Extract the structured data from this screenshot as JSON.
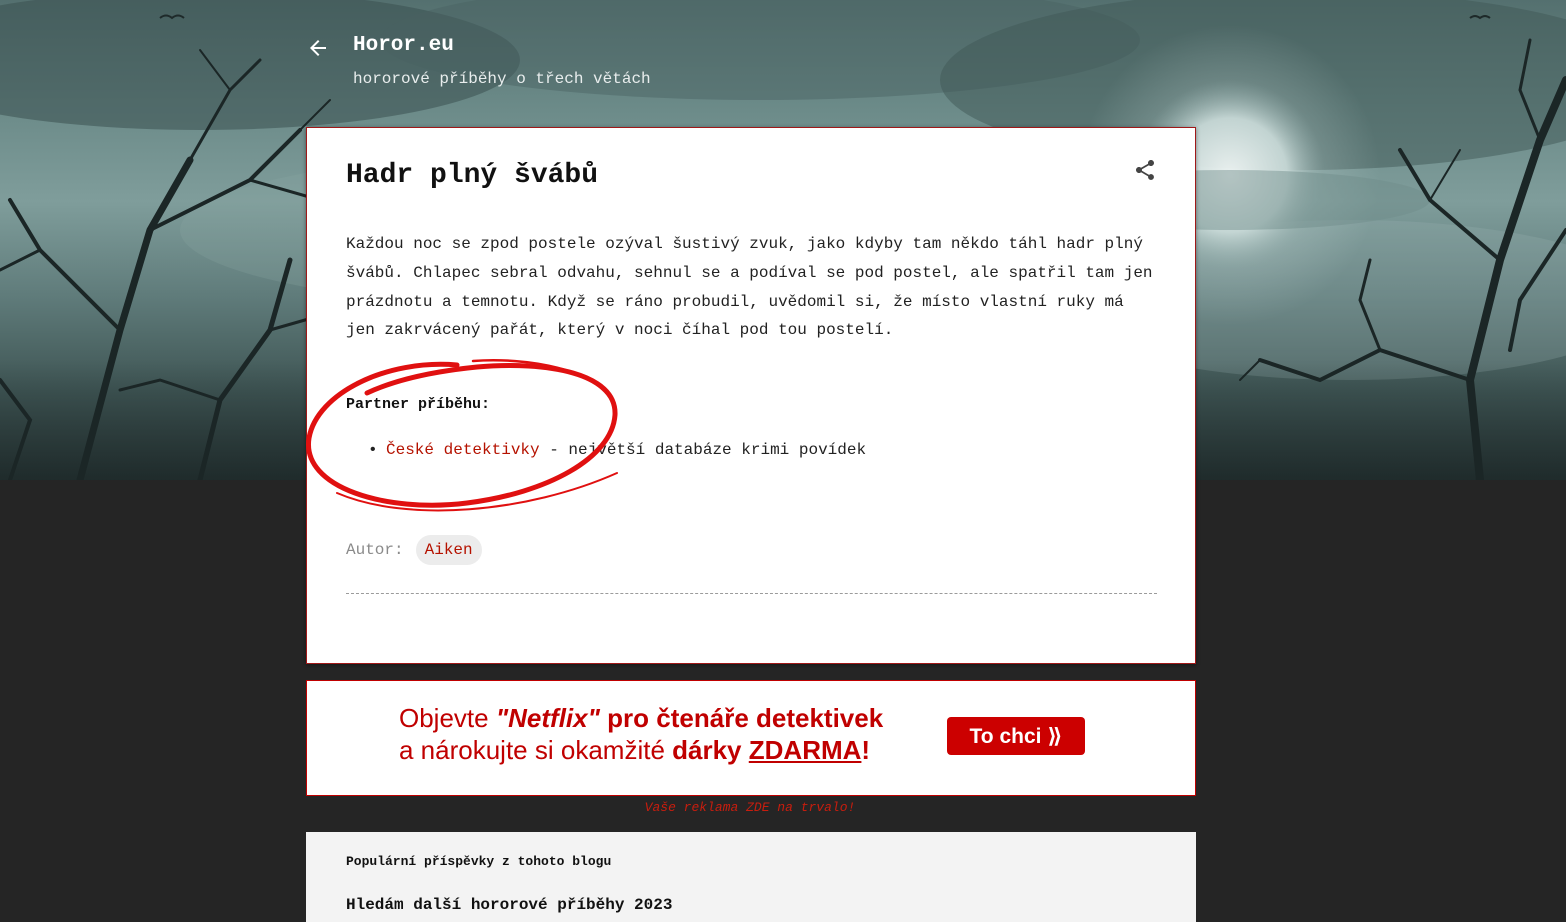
{
  "header": {
    "blog_title": "Horor.eu",
    "blog_subtitle": "hororové příběhy o třech větách",
    "back_icon": "arrow-left-icon"
  },
  "post": {
    "title": "Hadr plný švábů",
    "share_icon": "share-icon",
    "body": "Každou noc se zpod postele ozýval šustivý zvuk, jako kdyby tam někdo táhl hadr plný švábů. Chlapec sebral odvahu, sehnul se a podíval se pod postel, ale spatřil tam jen prázdnotu a temnotu. Když se ráno probudil, uvědomil si, že místo vlastní ruky má jen zakrvácený pařát, který v noci číhal pod tou postelí.",
    "partner_label": "Partner příběhu:",
    "partner_link": "České detektivky",
    "partner_desc": " - největší databáze krimi povídek",
    "author_label": "Autor:",
    "author_name": "Aiken"
  },
  "ad": {
    "line1_a": "Objevte ",
    "line1_b": "\"Netflix\"",
    "line1_c": " pro čtenáře detektivek",
    "line2_a": "a nárokujte si okamžité ",
    "line2_b": "dárky",
    "line2_c": " ",
    "line2_d": "ZDARMA",
    "line2_e": "!",
    "cta": "To chci ⟫",
    "note": "Vaše reklama ZDE na trvalo!"
  },
  "popular": {
    "heading": "Populární příspěvky z tohoto blogu",
    "first_item": "Hledám další hororové příběhy 2023"
  },
  "colors": {
    "accent_red": "#b51200",
    "card_border": "#a01818",
    "ad_red": "#c00000"
  }
}
